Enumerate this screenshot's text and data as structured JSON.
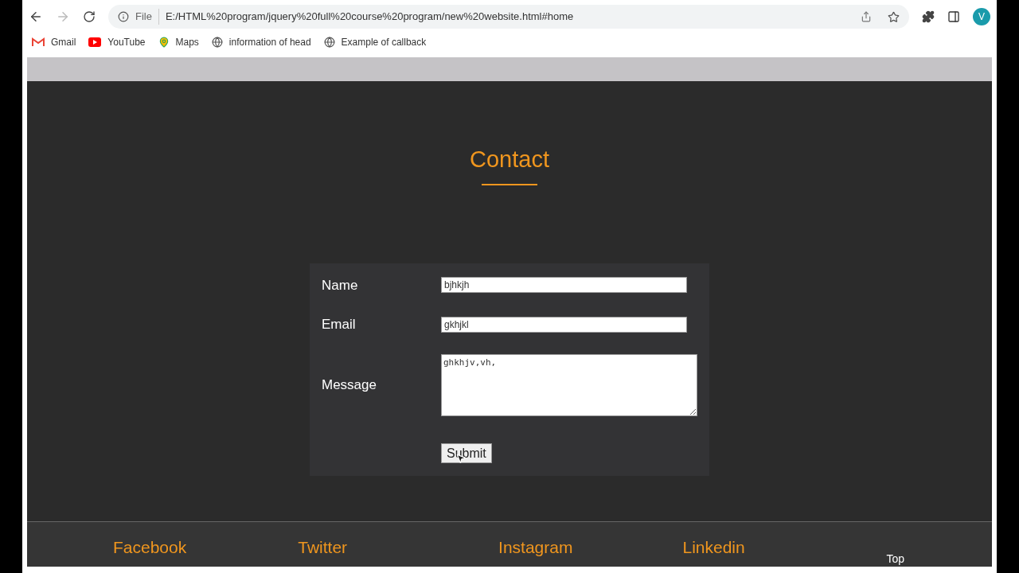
{
  "browser": {
    "url_label": "File",
    "url": "E:/HTML%20program/jquery%20full%20course%20program/new%20website.html#home",
    "profile_initial": "V",
    "bookmarks": [
      {
        "kind": "gmail",
        "label": "Gmail"
      },
      {
        "kind": "youtube",
        "label": "YouTube"
      },
      {
        "kind": "maps",
        "label": "Maps"
      },
      {
        "kind": "globe",
        "label": "information of head"
      },
      {
        "kind": "globe",
        "label": "Example of callback"
      }
    ]
  },
  "page": {
    "heading": "Contact",
    "form": {
      "fields": [
        {
          "kind": "input",
          "label": "Name",
          "value": "bjhkjh"
        },
        {
          "kind": "input",
          "label": "Email",
          "value": "gkhjkl"
        },
        {
          "kind": "textarea",
          "label": "Message",
          "value": "ghkhjv,vh,"
        }
      ],
      "submit": "Submit"
    },
    "footer": {
      "links": [
        "Facebook",
        "Twitter",
        "Instagram",
        "Linkedin"
      ],
      "top": "Top"
    }
  }
}
